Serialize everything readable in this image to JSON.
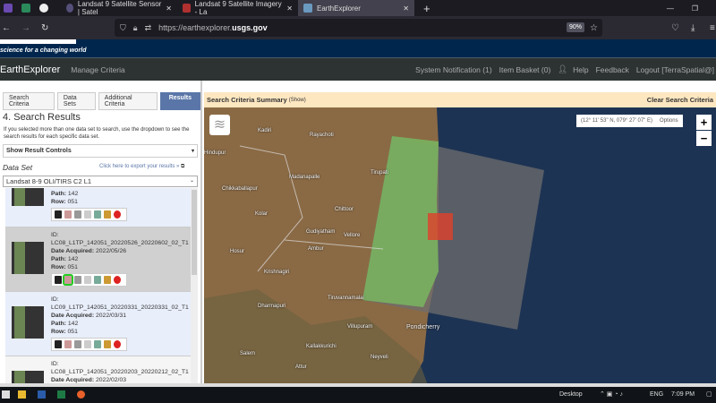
{
  "browser": {
    "tabs": [
      {
        "label": "Landsat 9 Satellite Sensor | Satel"
      },
      {
        "label": "Landsat 9 Satellite Imagery - La"
      },
      {
        "label": "EarthExplorer"
      }
    ],
    "url_prefix": "https://earthexplorer.",
    "url_domain": "usgs.gov",
    "zoom": "90%"
  },
  "banner": {
    "tagline": "science for a changing world"
  },
  "menu": {
    "app_title": "EarthExplorer",
    "manage": "Manage Criteria",
    "notification": "System Notification (1)",
    "basket": "Item Basket (0)",
    "help": "Help",
    "feedback": "Feedback",
    "logout": "Logout [TerraSpatial@]"
  },
  "sidebar": {
    "tabs": [
      "Search Criteria",
      "Data Sets",
      "Additional Criteria",
      "Results"
    ],
    "heading": "4. Search Results",
    "description": "If you selected more than one data set to search, use the dropdown to see the search results for each specific data set.",
    "result_controls": "Show Result Controls",
    "dataset_label": "Data Set",
    "export_link": "Click here to export your results »",
    "dataset_value": "Landsat 8-9 OLI/TIRS C2 L1",
    "labels": {
      "id": "ID:",
      "date": "Date Acquired:",
      "path": "Path:",
      "row": "Row:"
    },
    "results": [
      {
        "id": "",
        "date": "",
        "path": "142",
        "row": "051"
      },
      {
        "id": "LC08_L1TP_142051_20220526_20220602_02_T1",
        "date": "2022/05/26",
        "path": "142",
        "row": "051"
      },
      {
        "id": "LC09_L1TP_142051_20220331_20220331_02_T1",
        "date": "2022/03/31",
        "path": "142",
        "row": "051"
      },
      {
        "id": "LC08_L1TP_142051_20220203_20220212_02_T1",
        "date": "2022/02/03",
        "path": "",
        "row": ""
      }
    ]
  },
  "map": {
    "summary_title": "Search Criteria Summary",
    "summary_show": "(Show)",
    "clear": "Clear Search Criteria",
    "coords": "(12° 11' 53\" N, 079° 27' 07\" E)",
    "options": "Options",
    "zoom_in": "+",
    "zoom_out": "−",
    "places": [
      "Kadiri",
      "Rayachoti",
      "Hindupur",
      "Tirupati",
      "Madanapalle",
      "Chikkaballapur",
      "Chittoor",
      "Kolar",
      "Gudiyatham",
      "Vellore",
      "Ambur",
      "Hosur",
      "Krishnagiri",
      "Tiruvannamalai",
      "Dharmapuri",
      "Villupuram",
      "Pondicherry",
      "Kallakkurichi",
      "Salem",
      "Neyveli",
      "Attur"
    ]
  },
  "taskbar": {
    "desktop": "Desktop",
    "lang": "ENG",
    "time": "7:09 PM"
  }
}
